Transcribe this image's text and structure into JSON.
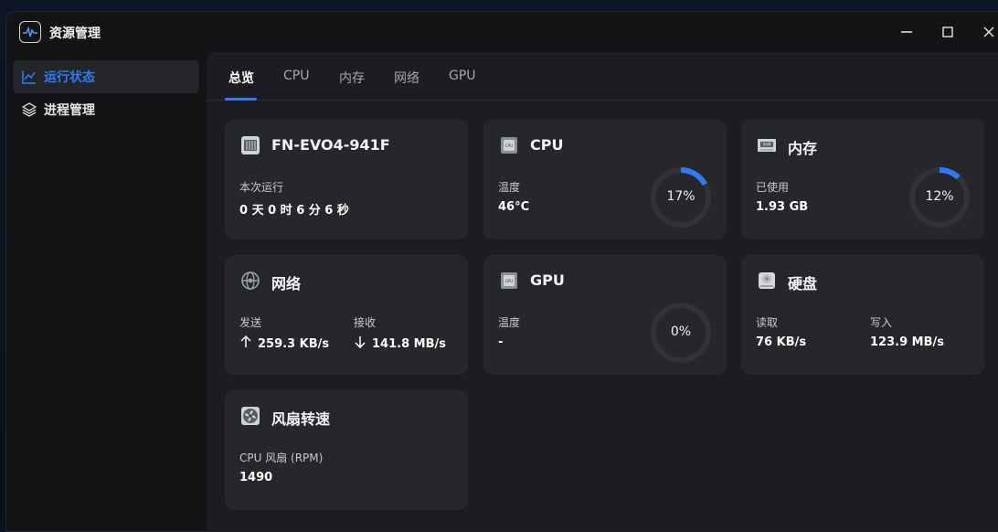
{
  "app": {
    "title": "资源管理",
    "logo_icon": "pulse-chart-icon"
  },
  "window_controls": {
    "minimize": "minimize-icon",
    "maximize": "maximize-icon",
    "close": "close-icon"
  },
  "sidebar": {
    "items": [
      {
        "label": "运行状态",
        "icon": "line-chart-icon",
        "active": true
      },
      {
        "label": "进程管理",
        "icon": "layers-icon",
        "active": false
      }
    ]
  },
  "tabs": [
    {
      "label": "总览",
      "active": true
    },
    {
      "label": "CPU",
      "active": false
    },
    {
      "label": "内存",
      "active": false
    },
    {
      "label": "网络",
      "active": false
    },
    {
      "label": "GPU",
      "active": false
    }
  ],
  "cards": {
    "system": {
      "title": "FN-EVO4-941F",
      "icon": "motherboard-icon",
      "uptime_label": "本次运行",
      "uptime_value": "0 天 0 时 6 分 6 秒"
    },
    "cpu": {
      "title": "CPU",
      "icon": "cpu-chip-icon",
      "temp_label": "温度",
      "temp_value": "46°C",
      "usage_text": "17%",
      "usage": 0.17
    },
    "memory": {
      "title": "内存",
      "icon": "ram-icon",
      "used_label": "已使用",
      "used_value": "1.93 GB",
      "usage_text": "12%",
      "usage": 0.12
    },
    "network": {
      "title": "网络",
      "icon": "globe-icon",
      "send_label": "发送",
      "send_value": "259.3 KB/s",
      "recv_label": "接收",
      "recv_value": "141.8 MB/s",
      "send_icon": "arrow-up-icon",
      "recv_icon": "arrow-down-icon"
    },
    "gpu": {
      "title": "GPU",
      "icon": "gpu-chip-icon",
      "temp_label": "温度",
      "temp_value": "-",
      "usage_text": "0%",
      "usage": 0
    },
    "disk": {
      "title": "硬盘",
      "icon": "disk-icon",
      "read_label": "读取",
      "read_value": "76 KB/s",
      "write_label": "写入",
      "write_value": "123.9 MB/s"
    },
    "fan": {
      "title": "风扇转速",
      "icon": "fan-icon",
      "rpm_label": "CPU 风扇 (RPM)",
      "rpm_value": "1490"
    }
  },
  "colors": {
    "accent": "#2f7bf5",
    "ring_track": "#323338",
    "card_bg": "#26272a"
  }
}
